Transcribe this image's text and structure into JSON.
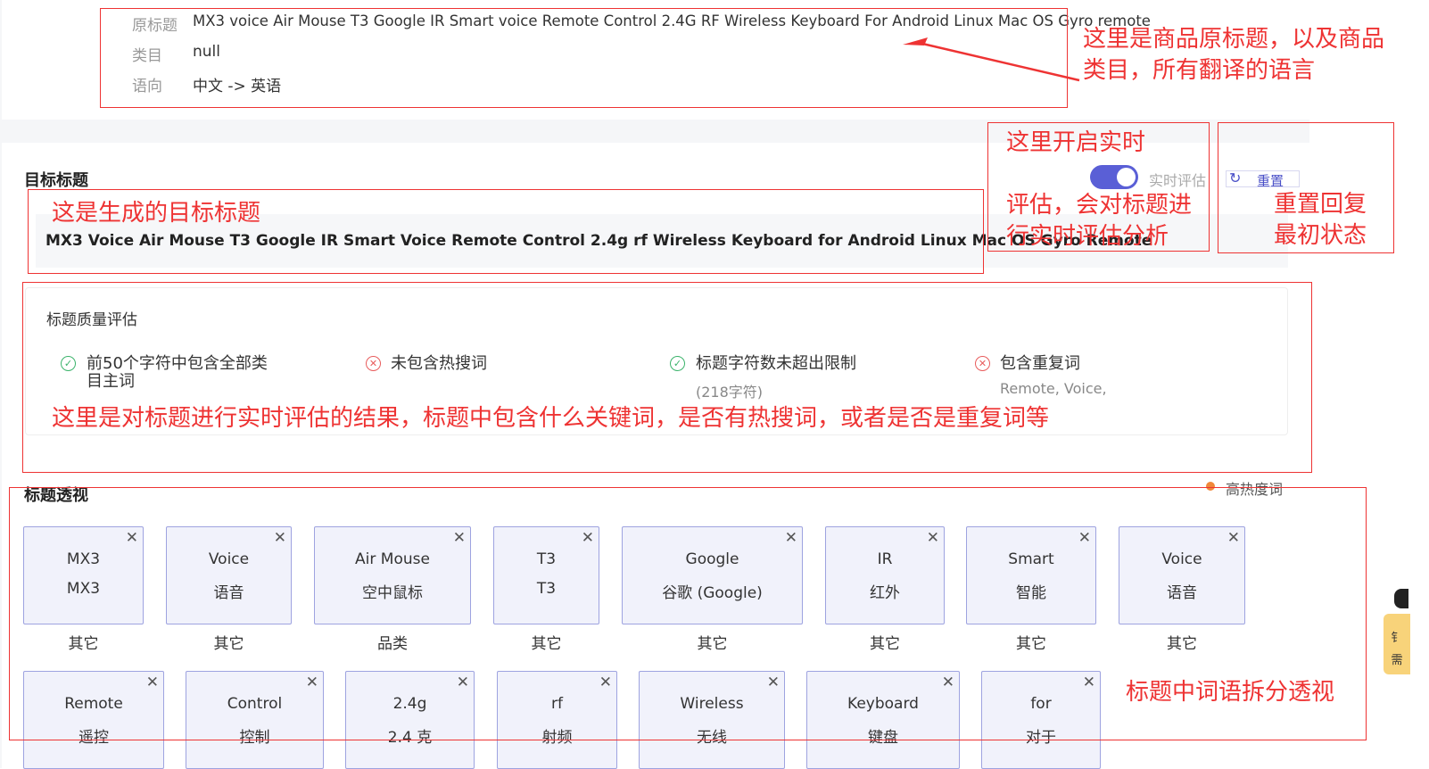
{
  "product_info": {
    "original_title_label": "原标题",
    "original_title_value": "MX3 voice Air Mouse T3 Google IR Smart voice Remote Control 2.4G RF Wireless Keyboard For Android Linux Mac OS Gyro remote",
    "category_label": "类目",
    "category_value": "null",
    "language_label": "语向",
    "language_value": "中文 -> 英语"
  },
  "target_title": {
    "heading": "目标标题",
    "value": "MX3 Voice Air Mouse T3 Google IR Smart Voice Remote Control 2.4g rf Wireless Keyboard for Android Linux Mac OS Gyro Remote",
    "realtime_toggle_label": "实时评估",
    "realtime_toggle_on": true,
    "reset_label": "重置",
    "toggle_color": "#5a5fd6"
  },
  "evaluation": {
    "heading": "标题质量评估",
    "items": [
      {
        "status": "pass",
        "icon": "check-circle-icon",
        "text_line1": "前50个字符中包含全部类",
        "text_line2": "目主词",
        "sub": ""
      },
      {
        "status": "fail",
        "icon": "x-circle-icon",
        "text_line1": "未包含热搜词",
        "text_line2": "",
        "sub": ""
      },
      {
        "status": "pass",
        "icon": "check-circle-icon",
        "text_line1": "标题字符数未超出限制",
        "text_line2": "",
        "sub": "(218字符)"
      },
      {
        "status": "fail",
        "icon": "x-circle-icon",
        "text_line1": "包含重复词",
        "text_line2": "",
        "sub": "Remote, Voice,"
      }
    ],
    "pass_color": "#3bb36b",
    "fail_color": "#e85c5c"
  },
  "perspective": {
    "heading": "标题透视",
    "legend_label": "高热度词",
    "legend_color": "#f0883a",
    "row1": [
      {
        "en": "MX3",
        "zh": "MX3",
        "category": "其它"
      },
      {
        "en": "Voice",
        "zh": "语音",
        "category": "其它"
      },
      {
        "en": "Air Mouse",
        "zh": "空中鼠标",
        "category": "品类"
      },
      {
        "en": "T3",
        "zh": "T3",
        "category": "其它"
      },
      {
        "en": "Google",
        "zh": "谷歌 (Google)",
        "category": "其它"
      },
      {
        "en": "IR",
        "zh": "红外",
        "category": "其它"
      },
      {
        "en": "Smart",
        "zh": "智能",
        "category": "其它"
      },
      {
        "en": "Voice",
        "zh": "语音",
        "category": "其它"
      }
    ],
    "row2": [
      {
        "en": "Remote",
        "zh": "遥控"
      },
      {
        "en": "Control",
        "zh": "控制"
      },
      {
        "en": "2.4g",
        "zh": "2.4 克"
      },
      {
        "en": "rf",
        "zh": "射频"
      },
      {
        "en": "Wireless",
        "zh": "无线"
      },
      {
        "en": "Keyboard",
        "zh": "键盘"
      },
      {
        "en": "for",
        "zh": "对于"
      }
    ],
    "close_symbol": "✕"
  },
  "annotations": {
    "color": "#ee3333",
    "original_title_note_line1": "这里是商品原标题，以及商品",
    "original_title_note_line2": "类目，所有翻译的语言",
    "realtime_note_line1": "这里开启实时",
    "realtime_note_line2": "评估，会对标题进",
    "realtime_note_line3": "行实时评估分析",
    "reset_note_line1": "重置回复",
    "reset_note_line2": "最初状态",
    "generated_title_note": "这是生成的目标标题",
    "evaluation_note": "这里是对标题进行实时评估的结果，标题中包含什么关键词，是否有热搜词，或者是否是重复词等",
    "perspective_note": "标题中词语拆分透视"
  },
  "side_widget": {
    "line1": "钅",
    "line2": "需"
  }
}
